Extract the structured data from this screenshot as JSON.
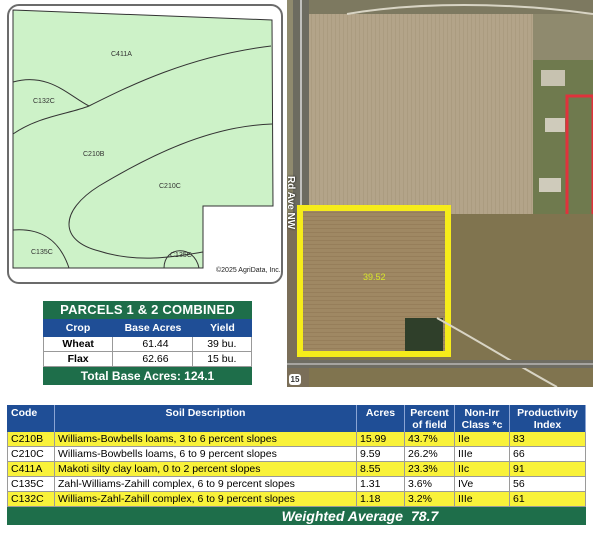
{
  "soil_map": {
    "labels": [
      "C411A",
      "C132C",
      "C210B",
      "C210C",
      "C135C",
      "C135C"
    ],
    "copyright": "©2025 AgriData, Inc.",
    "fill_color": "#cdf2c8"
  },
  "parcels": {
    "title": "PARCELS 1 & 2 COMBINED",
    "headers": [
      "Crop",
      "Base Acres",
      "Yield"
    ],
    "rows": [
      {
        "crop": "Wheat",
        "base_acres": "61.44",
        "yield": "39 bu."
      },
      {
        "crop": "Flax",
        "base_acres": "62.66",
        "yield": "15 bu."
      }
    ],
    "total": "Total Base Acres: 124.1"
  },
  "aerial": {
    "tract_acres": "39.52",
    "road_name": "Rd Ave NW",
    "route_badge": "15"
  },
  "soil_table": {
    "headers": [
      "Code",
      "Soil Description",
      "Acres",
      "Percent of field",
      "Non-Irr Class *c",
      "Productivity Index"
    ],
    "rows": [
      {
        "code": "C210B",
        "description": "Williams-Bowbells loams, 3 to 6 percent slopes",
        "acres": "15.99",
        "percent": "43.7%",
        "class": "IIe",
        "index": "83"
      },
      {
        "code": "C210C",
        "description": "Williams-Bowbells loams, 6 to 9 percent slopes",
        "acres": "9.59",
        "percent": "26.2%",
        "class": "IIIe",
        "index": "66"
      },
      {
        "code": "C411A",
        "description": "Makoti silty clay loam, 0 to 2 percent slopes",
        "acres": "8.55",
        "percent": "23.3%",
        "class": "IIc",
        "index": "91"
      },
      {
        "code": "C135C",
        "description": "Zahl-Williams-Zahill complex, 6 to 9 percent slopes",
        "acres": "1.31",
        "percent": "3.6%",
        "class": "IVe",
        "index": "56"
      },
      {
        "code": "C132C",
        "description": "Williams-Zahl-Zahill complex, 6 to 9 percent slopes",
        "acres": "1.18",
        "percent": "3.2%",
        "class": "IIIe",
        "index": "61"
      }
    ],
    "weighted_label": "Weighted Average",
    "weighted_value": "78.7"
  },
  "colors": {
    "header_blue": "#1f4e96",
    "header_green": "#1e6e4a",
    "highlight_yellow": "#f9f23a"
  }
}
